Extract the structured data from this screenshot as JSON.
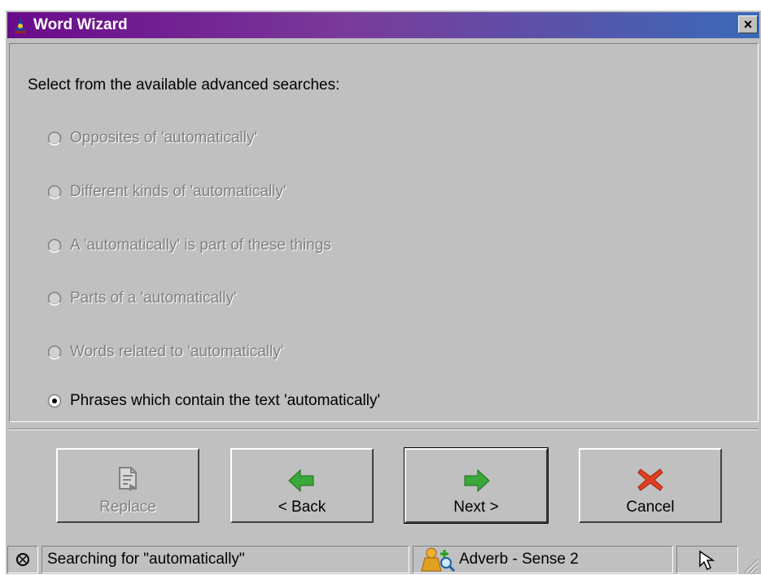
{
  "window": {
    "title": "Word Wizard",
    "close_label": "×"
  },
  "content": {
    "prompt": "Select from the available advanced searches:",
    "options": [
      {
        "label": "Opposites of 'automatically'",
        "enabled": false,
        "selected": false
      },
      {
        "label": "Different kinds of 'automatically'",
        "enabled": false,
        "selected": false
      },
      {
        "label": "A 'automatically' is part of these things",
        "enabled": false,
        "selected": false
      },
      {
        "label": "Parts of a 'automatically'",
        "enabled": false,
        "selected": false
      },
      {
        "label": "Words related to 'automatically'",
        "enabled": false,
        "selected": false
      },
      {
        "label": "Phrases which contain the text 'automatically'",
        "enabled": true,
        "selected": true
      }
    ]
  },
  "buttons": {
    "replace": {
      "label": "Replace",
      "icon": "replace-document-icon",
      "enabled": false
    },
    "back": {
      "label": "< Back",
      "icon": "green-left-arrow-icon",
      "enabled": true
    },
    "next": {
      "label": "Next >",
      "icon": "green-right-arrow-icon",
      "enabled": true
    },
    "cancel": {
      "label": "Cancel",
      "icon": "red-x-icon",
      "enabled": true
    }
  },
  "statusbar": {
    "status_text": "Searching for \"automatically\"",
    "part_of_speech": "Adverb - Sense 2"
  },
  "colors": {
    "title_gradient_start": "#6a0a8a",
    "title_gradient_end": "#3a6ab8",
    "face": "#c0c0c0",
    "disabled_text": "#808080",
    "arrow_green": "#3aa83a",
    "cancel_red": "#e04020"
  }
}
